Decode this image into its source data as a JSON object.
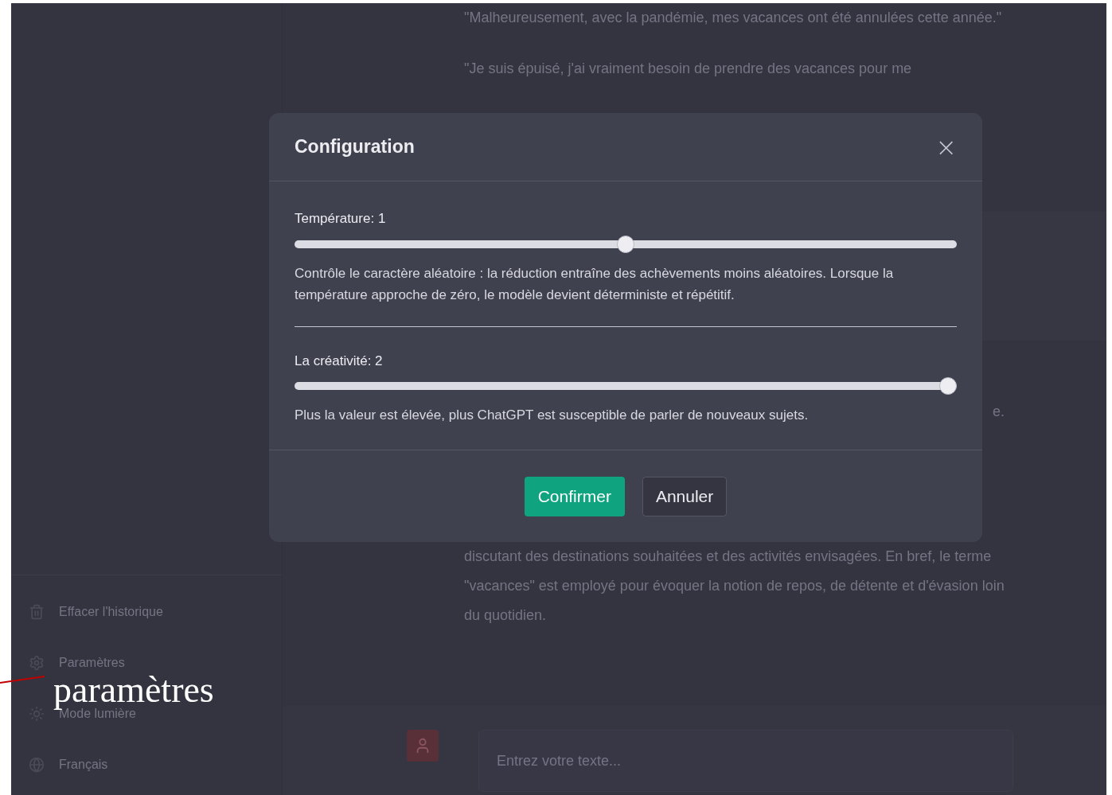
{
  "sidebar": {
    "items": [
      {
        "kind": "trash",
        "label": "Effacer l'historique"
      },
      {
        "kind": "gear",
        "label": "Paramètres"
      },
      {
        "kind": "sun",
        "label": "Mode lumière"
      },
      {
        "kind": "globe",
        "label": "Français"
      }
    ]
  },
  "chat": {
    "top_paragraphs": [
      "\"Malheureusement, avec la pandémie, mes vacances ont été annulées cette année.\"",
      "\"Je suis épuisé, j'ai vraiment besoin de prendre des vacances pour me"
    ],
    "fragment": "e.",
    "bottom_paragraph": "discutant des destinations souhaitées et des activités envisagées. En bref, le terme \"vacances\" est employé pour évoquer la notion de repos, de détente et d'évasion loin du quotidien.",
    "input": {
      "placeholder": "Entrez votre texte..."
    }
  },
  "dialog": {
    "title": "Configuration",
    "close": "×",
    "settings": [
      {
        "label": "Température: 1",
        "level": 0.5,
        "description": "Contrôle le caractère aléatoire : la réduction entraîne des achèvements moins aléatoires. Lorsque la température approche de zéro, le modèle devient déterministe et répétitif."
      },
      {
        "label": "La créativité: 2",
        "level": 1,
        "description": "Plus la valeur est élevée, plus ChatGPT est susceptible de parler de nouveaux sujets."
      }
    ],
    "buttons": [
      {
        "kind": "primary",
        "label": "Confirmer"
      },
      {
        "kind": "secondary",
        "label": "Annuler"
      }
    ]
  },
  "annotation": {
    "label": "paramètres"
  }
}
